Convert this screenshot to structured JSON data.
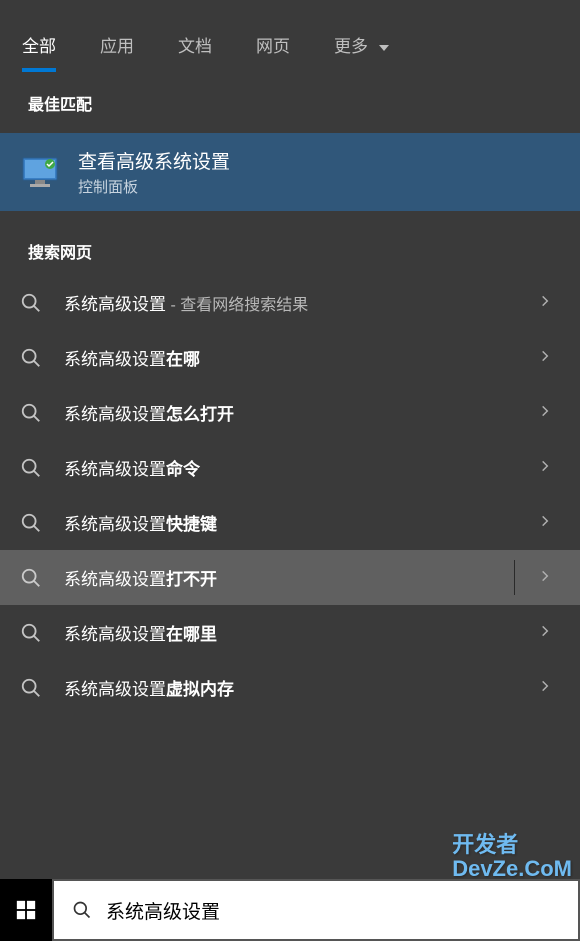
{
  "tabs": {
    "all": "全部",
    "app": "应用",
    "doc": "文档",
    "web": "网页",
    "more": "更多"
  },
  "sections": {
    "best_match": "最佳匹配",
    "web_search": "搜索网页"
  },
  "best_match": {
    "title": "查看高级系统设置",
    "subtitle": "控制面板"
  },
  "search_items": [
    {
      "prefix": "系统高级设置",
      "bold": "",
      "suffix": " - 查看网络搜索结果"
    },
    {
      "prefix": "系统高级设置",
      "bold": "在哪",
      "suffix": ""
    },
    {
      "prefix": "系统高级设置",
      "bold": "怎么打开",
      "suffix": ""
    },
    {
      "prefix": "系统高级设置",
      "bold": "命令",
      "suffix": ""
    },
    {
      "prefix": "系统高级设置",
      "bold": "快捷键",
      "suffix": ""
    },
    {
      "prefix": "系统高级设置",
      "bold": "打不开",
      "suffix": ""
    },
    {
      "prefix": "系统高级设置",
      "bold": "在哪里",
      "suffix": ""
    },
    {
      "prefix": "系统高级设置",
      "bold": "虚拟内存",
      "suffix": ""
    }
  ],
  "hover_index": 5,
  "search_input": "系统高级设置",
  "watermark": {
    "line1": "开发者",
    "line2": "DevZe.CoM"
  },
  "colors": {
    "accent": "#0078d4",
    "selected_bg": "#30577a",
    "hover_bg": "#606060",
    "panel_bg": "#3a3a3a"
  }
}
